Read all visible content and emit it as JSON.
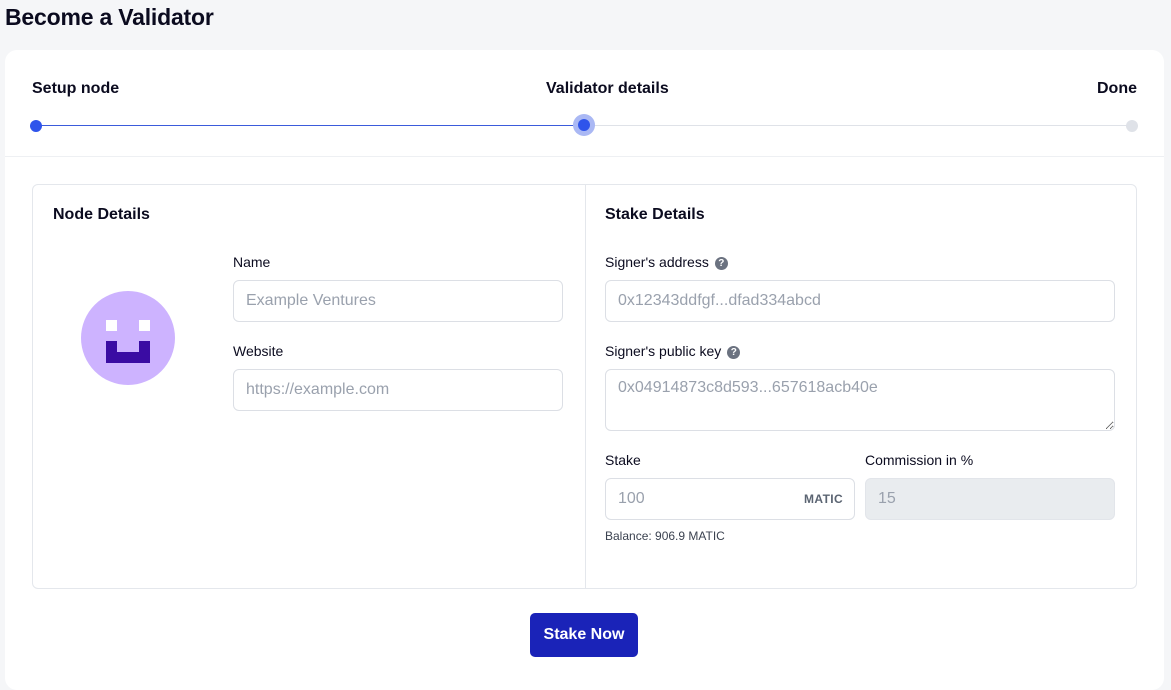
{
  "page": {
    "title": "Become a Validator"
  },
  "stepper": {
    "steps": [
      {
        "label": "Setup node",
        "state": "completed"
      },
      {
        "label": "Validator details",
        "state": "active"
      },
      {
        "label": "Done",
        "state": "pending"
      }
    ],
    "colors": {
      "active": "#2f54eb",
      "pending": "#dfe2e8"
    }
  },
  "node_details": {
    "title": "Node Details",
    "avatar_icon": "smiley-avatar-icon",
    "name": {
      "label": "Name",
      "placeholder": "Example Ventures",
      "value": ""
    },
    "website": {
      "label": "Website",
      "placeholder": "https://example.com",
      "value": ""
    }
  },
  "stake_details": {
    "title": "Stake Details",
    "signer_address": {
      "label": "Signer's address",
      "help_icon": "question-icon",
      "help_glyph": "?",
      "placeholder": "0x12343ddfgf...dfad334abcd",
      "value": ""
    },
    "signer_public_key": {
      "label": "Signer's public key",
      "help_icon": "question-icon",
      "help_glyph": "?",
      "placeholder": "0x04914873c8d593...657618acb40e",
      "value": ""
    },
    "stake": {
      "label": "Stake",
      "placeholder": "100",
      "suffix": "MATIC",
      "value": ""
    },
    "commission": {
      "label": "Commission in %",
      "placeholder": "15",
      "disabled": true
    },
    "balance": "Balance: 906.9 MATIC"
  },
  "actions": {
    "stake_now": "Stake Now",
    "button_color": "#1a23b8"
  }
}
